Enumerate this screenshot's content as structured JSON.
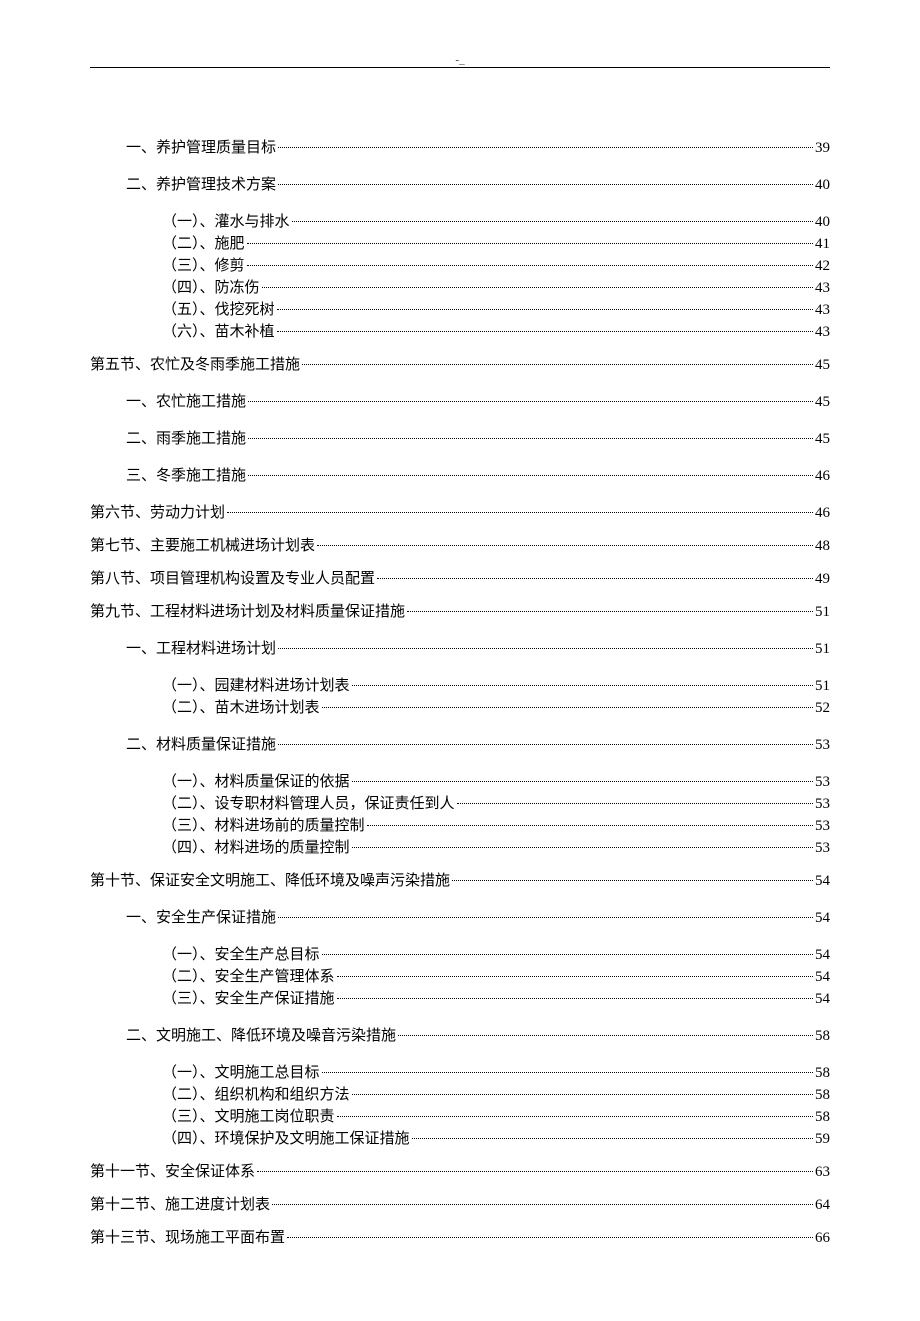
{
  "header_marker": "-_",
  "toc": [
    {
      "level": 2,
      "label": "一、养护管理质量目标",
      "page": "39"
    },
    {
      "level": 2,
      "label": "二、养护管理技术方案",
      "page": "40"
    },
    {
      "level": 3,
      "label": "（一）、灌水与排水",
      "page": "40"
    },
    {
      "level": 3,
      "label": "（二）、施肥",
      "page": "41"
    },
    {
      "level": 3,
      "label": "（三）、修剪",
      "page": "42"
    },
    {
      "level": 3,
      "label": "（四）、防冻伤",
      "page": "43"
    },
    {
      "level": 3,
      "label": "（五）、伐挖死树",
      "page": "43"
    },
    {
      "level": 3,
      "label": "（六）、苗木补植",
      "page": "43"
    },
    {
      "level": 1,
      "label": "第五节、农忙及冬雨季施工措施",
      "page": "45"
    },
    {
      "level": 2,
      "label": "一、农忙施工措施",
      "page": "45"
    },
    {
      "level": 2,
      "label": "二、雨季施工措施",
      "page": "45"
    },
    {
      "level": 2,
      "label": "三、冬季施工措施",
      "page": "46"
    },
    {
      "level": 1,
      "label": "第六节、劳动力计划",
      "page": "46"
    },
    {
      "level": 1,
      "label": "第七节、主要施工机械进场计划表",
      "page": "48"
    },
    {
      "level": 1,
      "label": "第八节、项目管理机构设置及专业人员配置",
      "page": "49"
    },
    {
      "level": 1,
      "label": "第九节、工程材料进场计划及材料质量保证措施",
      "page": "51"
    },
    {
      "level": 2,
      "label": "一、工程材料进场计划",
      "page": "51"
    },
    {
      "level": 3,
      "label": "（一）、园建材料进场计划表",
      "page": "51"
    },
    {
      "level": 3,
      "label": "（二）、苗木进场计划表",
      "page": "52"
    },
    {
      "level": 2,
      "label": "二、材料质量保证措施",
      "page": "53"
    },
    {
      "level": 3,
      "label": "（一）、材料质量保证的依据",
      "page": "53"
    },
    {
      "level": 3,
      "label": "（二）、设专职材料管理人员，保证责任到人",
      "page": "53"
    },
    {
      "level": 3,
      "label": "（三）、材料进场前的质量控制",
      "page": "53"
    },
    {
      "level": 3,
      "label": "（四）、材料进场的质量控制",
      "page": "53"
    },
    {
      "level": 1,
      "label": "第十节、保证安全文明施工、降低环境及噪声污染措施",
      "page": "54"
    },
    {
      "level": 2,
      "label": "一、安全生产保证措施",
      "page": "54"
    },
    {
      "level": 3,
      "label": "（一）、安全生产总目标",
      "page": "54"
    },
    {
      "level": 3,
      "label": "（二）、安全生产管理体系",
      "page": "54"
    },
    {
      "level": 3,
      "label": "（三）、安全生产保证措施",
      "page": "54"
    },
    {
      "level": 2,
      "label": "二、文明施工、降低环境及噪音污染措施",
      "page": "58"
    },
    {
      "level": 3,
      "label": "（一）、文明施工总目标",
      "page": "58"
    },
    {
      "level": 3,
      "label": "（二）、组织机构和组织方法",
      "page": "58"
    },
    {
      "level": 3,
      "label": "（三）、文明施工岗位职责",
      "page": "58"
    },
    {
      "level": 3,
      "label": "（四）、环境保护及文明施工保证措施",
      "page": "59"
    },
    {
      "level": 1,
      "label": "第十一节、安全保证体系",
      "page": "63"
    },
    {
      "level": 1,
      "label": "第十二节、施工进度计划表",
      "page": "64"
    },
    {
      "level": 1,
      "label": "第十三节、现场施工平面布置",
      "page": "66"
    }
  ]
}
